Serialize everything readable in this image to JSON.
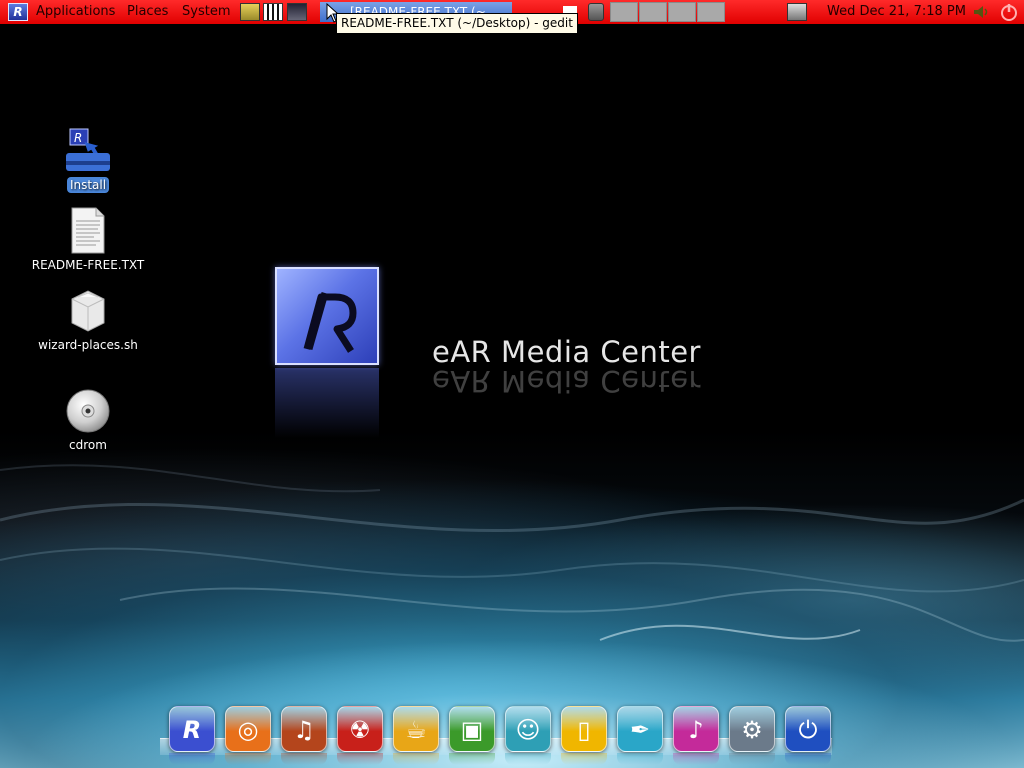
{
  "panel": {
    "menus": [
      "Applications",
      "Places",
      "System"
    ],
    "task_title": "[README-FREE.TXT (~",
    "tooltip": "README-FREE.TXT (~/Desktop) - gedit",
    "clock": "Wed Dec 21,  7:18 PM",
    "workspace_count": 4
  },
  "desktop_icons": [
    {
      "label": "Install",
      "icon": "install-icon",
      "selected": true
    },
    {
      "label": "README-FREE.TXT",
      "icon": "text-file-icon",
      "selected": false
    },
    {
      "label": "wizard-places.sh",
      "icon": "script-icon",
      "selected": false
    },
    {
      "label": "cdrom",
      "icon": "cdrom-icon",
      "selected": false
    }
  ],
  "branding": {
    "logo_letter": "R",
    "title": "eAR Media Center"
  },
  "dock": [
    {
      "icon": "ear-logo-icon",
      "color": "#3b4fd0"
    },
    {
      "icon": "firefox-icon",
      "color": "#e8701a"
    },
    {
      "icon": "guitar-icon",
      "color": "#b4451c"
    },
    {
      "icon": "burner-icon",
      "color": "#c8201a"
    },
    {
      "icon": "coffee-cup-icon",
      "color": "#e8a617"
    },
    {
      "icon": "image-viewer-icon",
      "color": "#3b9a2a"
    },
    {
      "icon": "messenger-icon",
      "color": "#2e9fb5"
    },
    {
      "icon": "office-icon",
      "color": "#f0b600"
    },
    {
      "icon": "feather-pen-icon",
      "color": "#2aa6c8"
    },
    {
      "icon": "music-icon",
      "color": "#c42a9a"
    },
    {
      "icon": "settings-icon",
      "color": "#6b7a8a"
    },
    {
      "icon": "power-icon",
      "color": "#1f4fc0"
    }
  ],
  "colors": {
    "panel": "#ff0000",
    "selection": "#4a86d9",
    "logo_blue": "#5c73e6"
  }
}
